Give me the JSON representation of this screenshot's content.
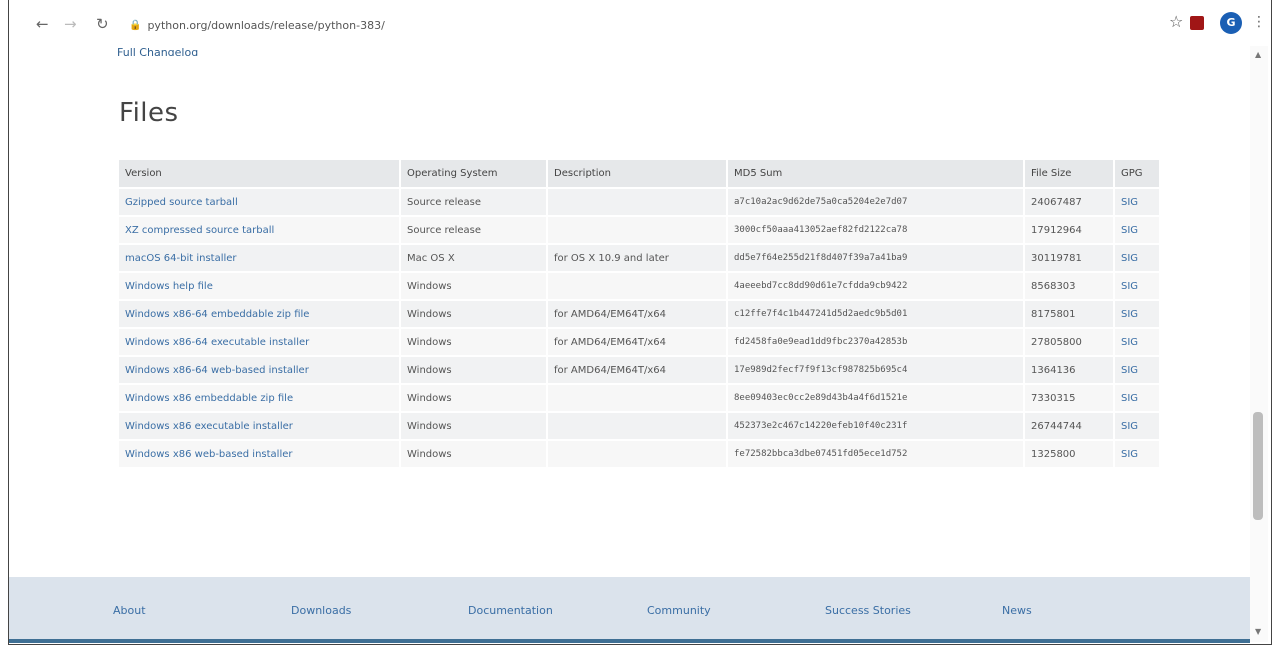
{
  "browser": {
    "url": "python.org/downloads/release/python-383/",
    "profile_initial": "G"
  },
  "page": {
    "prev_link": "Full Changelog",
    "heading": "Files"
  },
  "table": {
    "headers": [
      "Version",
      "Operating System",
      "Description",
      "MD5 Sum",
      "File Size",
      "GPG"
    ],
    "rows": [
      {
        "version": "Gzipped source tarball",
        "os": "Source release",
        "desc": "",
        "md5": "a7c10a2ac9d62de75a0ca5204e2e7d07",
        "size": "24067487",
        "gpg": "SIG"
      },
      {
        "version": "XZ compressed source tarball",
        "os": "Source release",
        "desc": "",
        "md5": "3000cf50aaa413052aef82fd2122ca78",
        "size": "17912964",
        "gpg": "SIG"
      },
      {
        "version": "macOS 64-bit installer",
        "os": "Mac OS X",
        "desc": "for OS X 10.9 and later",
        "md5": "dd5e7f64e255d21f8d407f39a7a41ba9",
        "size": "30119781",
        "gpg": "SIG"
      },
      {
        "version": "Windows help file",
        "os": "Windows",
        "desc": "",
        "md5": "4aeeebd7cc8dd90d61e7cfdda9cb9422",
        "size": "8568303",
        "gpg": "SIG"
      },
      {
        "version": "Windows x86-64 embeddable zip file",
        "os": "Windows",
        "desc": "for AMD64/EM64T/x64",
        "md5": "c12ffe7f4c1b447241d5d2aedc9b5d01",
        "size": "8175801",
        "gpg": "SIG"
      },
      {
        "version": "Windows x86-64 executable installer",
        "os": "Windows",
        "desc": "for AMD64/EM64T/x64",
        "md5": "fd2458fa0e9ead1dd9fbc2370a42853b",
        "size": "27805800",
        "gpg": "SIG"
      },
      {
        "version": "Windows x86-64 web-based installer",
        "os": "Windows",
        "desc": "for AMD64/EM64T/x64",
        "md5": "17e989d2fecf7f9f13cf987825b695c4",
        "size": "1364136",
        "gpg": "SIG"
      },
      {
        "version": "Windows x86 embeddable zip file",
        "os": "Windows",
        "desc": "",
        "md5": "8ee09403ec0cc2e89d43b4a4f6d1521e",
        "size": "7330315",
        "gpg": "SIG"
      },
      {
        "version": "Windows x86 executable installer",
        "os": "Windows",
        "desc": "",
        "md5": "452373e2c467c14220efeb10f40c231f",
        "size": "26744744",
        "gpg": "SIG"
      },
      {
        "version": "Windows x86 web-based installer",
        "os": "Windows",
        "desc": "",
        "md5": "fe72582bbca3dbe07451fd05ece1d752",
        "size": "1325800",
        "gpg": "SIG"
      }
    ]
  },
  "footer": {
    "links": [
      "About",
      "Downloads",
      "Documentation",
      "Community",
      "Success Stories",
      "News"
    ]
  }
}
